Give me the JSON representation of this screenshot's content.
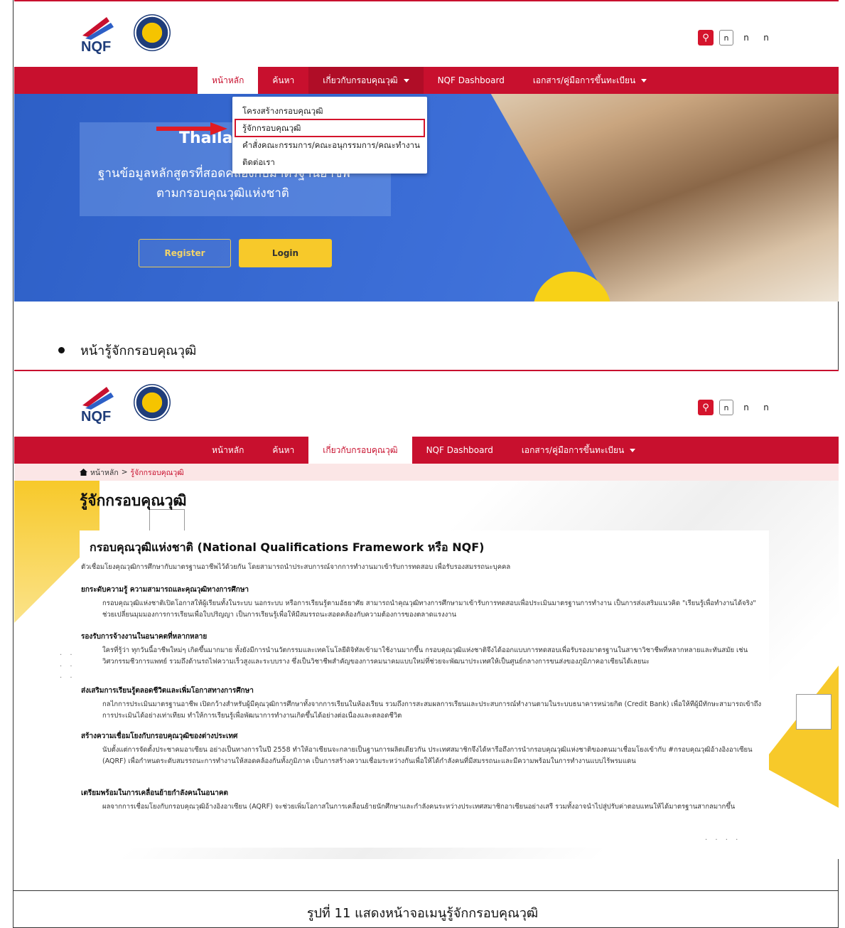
{
  "site": {
    "tools": {
      "box_label": "n",
      "t1": "n",
      "t2": "n"
    },
    "nav": [
      "หน้าหลัก",
      "ค้นหา",
      "เกี่ยวกับกรอบคุณวุฒิ",
      "NQF Dashboard",
      "เอกสาร/คู่มือการขึ้นทะเบียน"
    ]
  },
  "shot1": {
    "dropdown": [
      "โครงสร้างกรอบคุณวุฒิ",
      "รู้จักกรอบคุณวุฒิ",
      "คำสั่งคณะกรรมการ/คณะอนุกรรมการ/คณะทำงาน",
      "ติดต่อเรา"
    ],
    "hero_title": "Thailand",
    "hero_sub1": "ฐานข้อมูลหลักสูตรที่สอดคล้องกับมาตรฐานอาชีพ",
    "hero_sub2": "ตามกรอบคุณวุฒิแห่งชาติ",
    "register": "Register",
    "login": "Login"
  },
  "bullet": "หน้ารู้จักกรอบคุณวุฒิ",
  "shot2": {
    "breadcrumb_home": "หน้าหลัก",
    "breadcrumb_sep": ">",
    "breadcrumb_current": "รู้จักกรอบคุณวุฒิ",
    "page_title": "รู้จักกรอบคุณวุฒิ",
    "heading": "กรอบคุณวุฒิแห่งชาติ (National Qualifications Framework หรือ NQF)",
    "intro": "ตัวเชื่อมโยงคุณวุฒิการศึกษากับมาตรฐานอาชีพไว้ด้วยกัน โดยสามารถนำประสบการณ์จากการทำงานมาเข้ารับการทดสอบ เพื่อรับรองสมรรถนะบุคคล",
    "sections": [
      {
        "title": "ยกระดับความรู้ ความสามารถและคุณวุฒิทางการศึกษา",
        "body": "กรอบคุณวุฒิแห่งชาติเปิดโอกาสให้ผู้เรียนทั้งในระบบ นอกระบบ หรือการเรียนรู้ตามอัธยาศัย สามารถนำคุณวุฒิทางการศึกษามาเข้ารับการทดสอบเพื่อประเมินมาตรฐานการทำงาน เป็นการส่งเสริมแนวคิด \"เรียนรู้เพื่อทำงานได้จริง\" ช่วยเปลี่ยนมุมมองการการเรียนเพื่อใบปริญญา เป็นการเรียนรู้เพื่อให้มีสมรรถนะสอดคล้องกับความต้องการของตลาดแรงงาน"
      },
      {
        "title": "รองรับการจ้างงานในอนาคตที่หลากหลาย",
        "body": "ใครที่รู้ว่า ทุกวันนี้อาชีพใหม่ๆ เกิดขึ้นมากมาย ทั้งยังมีการนำนวัตกรรมและเทคโนโลยีดิจิทัลเข้ามาใช้งานมากขึ้น กรอบคุณวุฒิแห่งชาติจึงได้ออกแบบการทดสอบเพื่อรับรองมาตรฐานในสาขาวิชาชีพที่หลากหลายและทันสมัย เช่น วิศวกรรมชีวการแพทย์ รวมถึงด้านรถไฟความเร็วสูงและระบบราง ซึ่งเป็นวิชาชีพสำคัญของการคมนาคมแบบใหม่ที่ช่วยจะพัฒนาประเทศให้เป็นศูนย์กลางการขนส่งของภูมิภาคอาเซียนได้เลยนะ"
      },
      {
        "title": "ส่งเสริมการเรียนรู้ตลอดชีวิตและเพิ่มโอกาสทางการศึกษา",
        "body": "กลไกการประเมินมาตรฐานอาชีพ เปิดกว้างสำหรับผู้มีคุณวุฒิการศึกษาทั้งจากการเรียนในห้องเรียน รวมถึงการสะสมผลการเรียนและประสบการณ์ทำงานตามในระบบธนาคารหน่วยกิต (Credit Bank) เพื่อให้ทีผู้มีทักษะสามารถเข้าถึงการประเมินได้อย่างเท่าเทียม ทำให้การเรียนรู้เพื่อพัฒนาการทำงานเกิดขึ้นได้อย่างต่อเนื่องและตลอดชีวิต"
      },
      {
        "title": "สร้างความเชื่อมโยงกับกรอบคุณวุฒิของต่างประเทศ",
        "body": "นับตั้งแต่การจัดตั้งประชาคมอาเซียน อย่างเป็นทางการในปี 2558 ทำให้อาเซียนจะกลายเป็นฐานการผลิตเดียวกัน ประเทศสมาชิกจึงได้หารือถึงการนำกรอบคุณวุฒิแห่งชาติของตนมาเชื่อมโยงเข้ากับ #กรอบคุณวุฒิอ้างอิงอาเซียน (AQRF) เพื่อกำหนดระดับสมรรถนะการทำงานให้สอดคล้องกันทั้งภูมิภาค เป็นการสร้างความเชื่อมระหว่างกันเพื่อให้ได้กำลังคนที่มีสมรรถนะและมีความพร้อมในการทำงานแบบไร้พรมแดน"
      },
      {
        "title": "เตรียมพร้อมในการเคลื่อนย้ายกำลังคนในอนาคต",
        "body": "ผลจากการเชื่อมโยงกับกรอบคุณวุฒิอ้างอิงอาเซียน (AQRF) จะช่วยเพิ่มโอกาสในการเคลื่อนย้ายนักศึกษาและกำลังคนระหว่างประเทศสมาชิกอาเซียนอย่างเสรี รวมทั้งอาจนำไปสู่ปรับค่าตอบแทนให้ได้มาตรฐานสากลมากขึ้น"
      }
    ],
    "dots": "· · · ·"
  },
  "caption": "รูปที่ 11 แสดงหน้าจอเมนูรู้จักกรอบคุณวุฒิ",
  "colors": {
    "brand_red": "#c8102e",
    "yellow": "#f7c92a",
    "hero_blue": "#3d6fd8"
  },
  "icons": [
    "nqf-logo",
    "seal-logo",
    "search-icon",
    "home-icon",
    "caret-down-icon",
    "red-arrow-icon"
  ]
}
